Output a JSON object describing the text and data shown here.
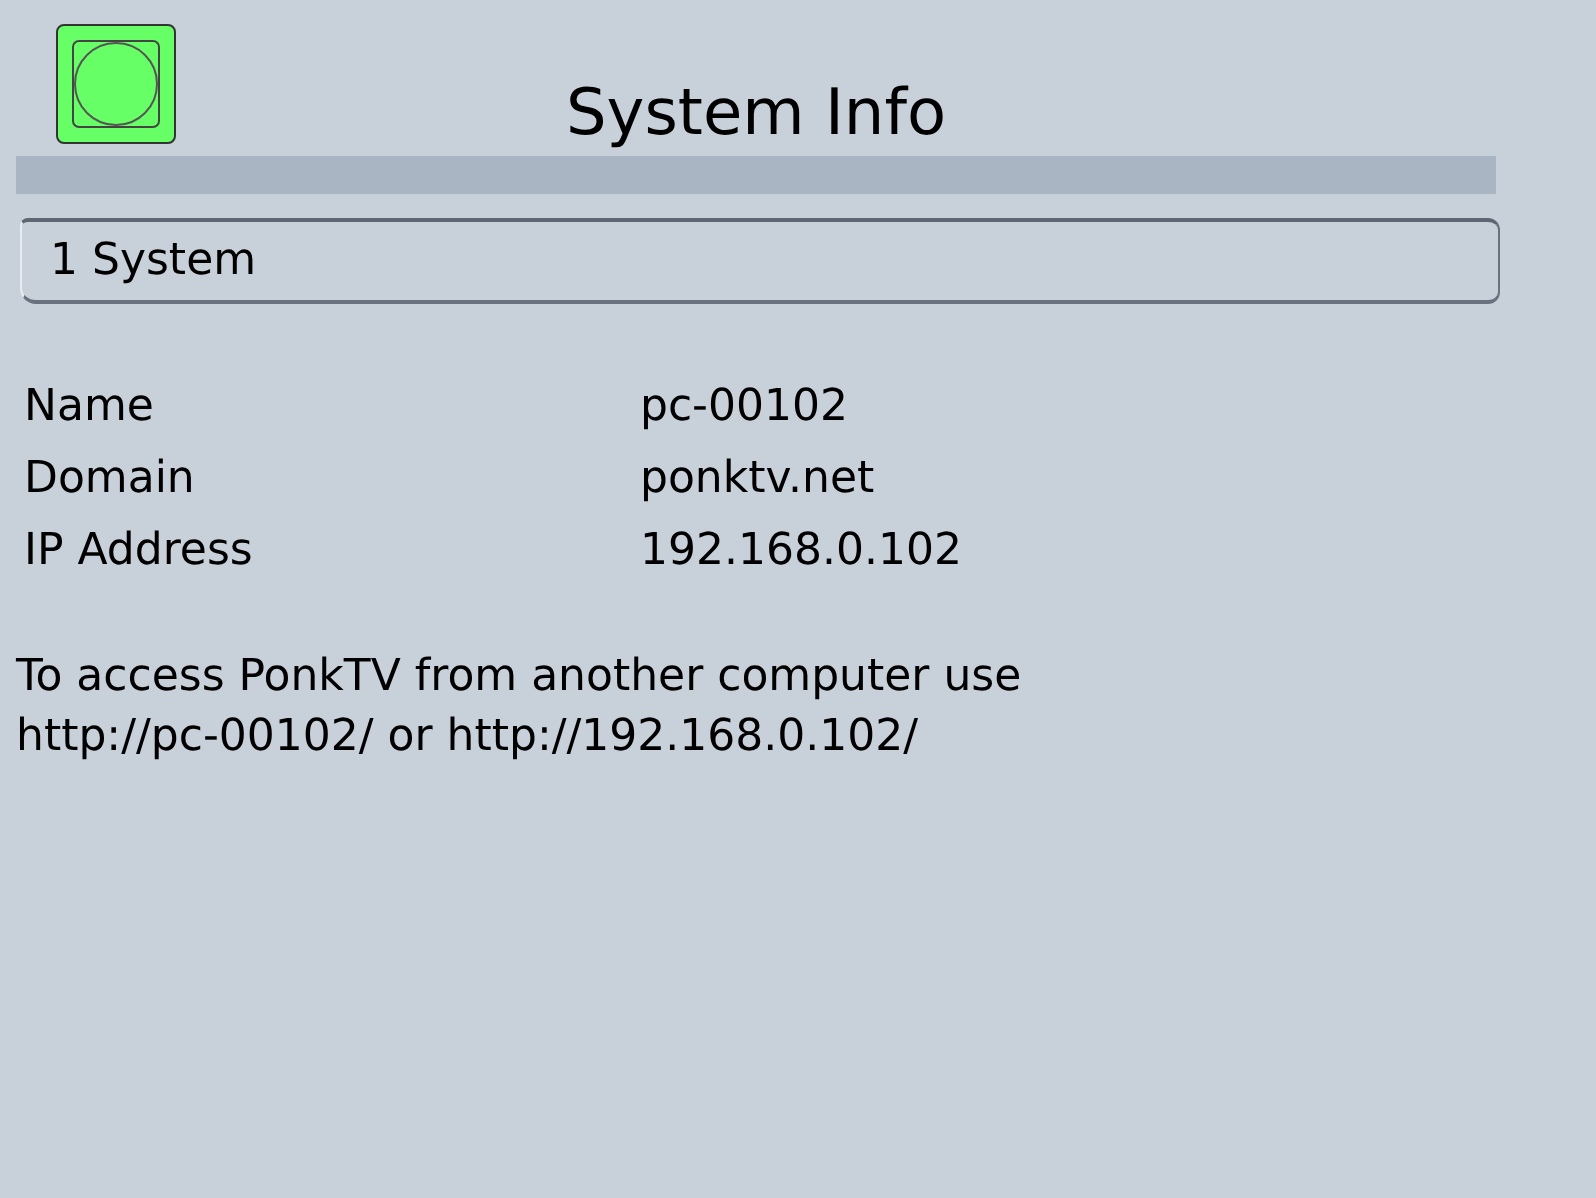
{
  "title": "System Info",
  "status_light": {
    "on": true
  },
  "section": {
    "label": "1 System"
  },
  "fields": [
    {
      "label": "Name",
      "value": "pc-00102"
    },
    {
      "label": "Domain",
      "value": "ponktv.net"
    },
    {
      "label": "IP Address",
      "value": "192.168.0.102"
    }
  ],
  "note": "To access PonkTV from another computer use http://pc-00102/ or http://192.168.0.102/"
}
